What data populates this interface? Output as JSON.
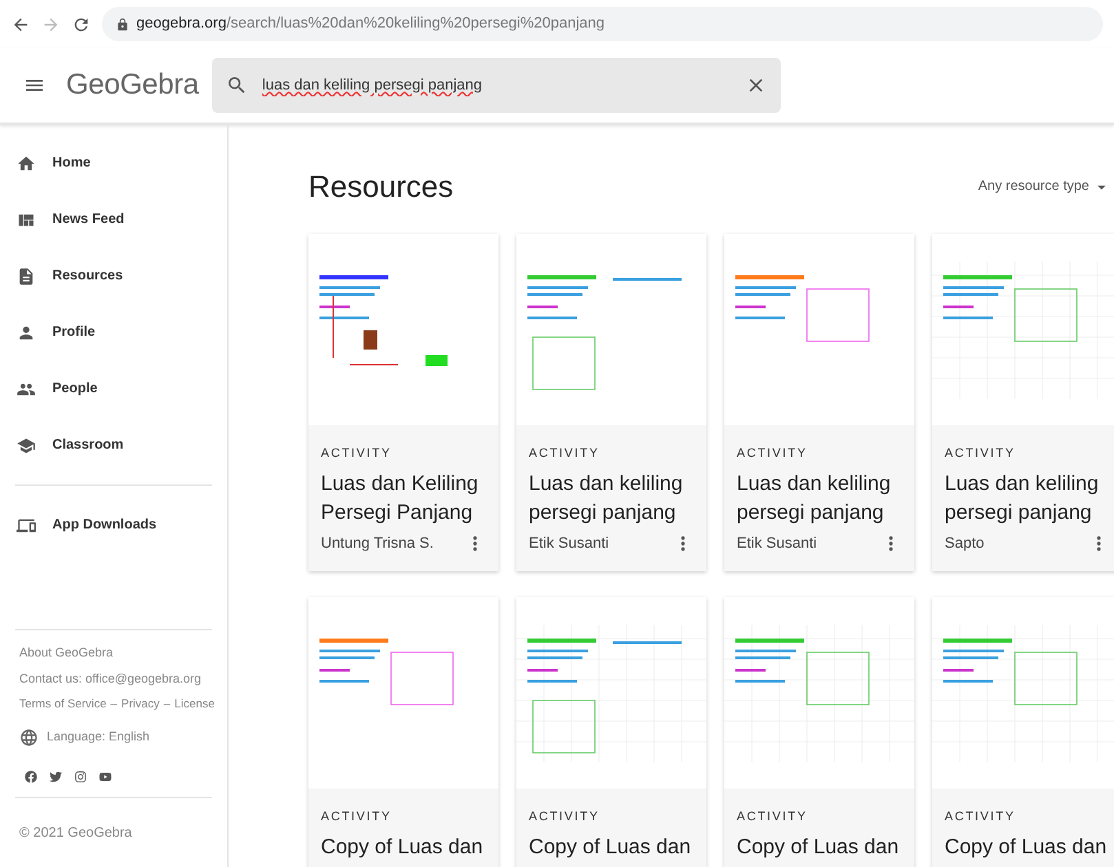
{
  "browser": {
    "url_host": "geogebra.org",
    "url_path": "/search/luas%20dan%20keliling%20persegi%20panjang"
  },
  "header": {
    "logo": "GeoGebra",
    "search": {
      "value": "luas dan keliling persegi panjang"
    }
  },
  "sidebar": {
    "items": [
      {
        "kind": "home",
        "label": "Home"
      },
      {
        "kind": "feed",
        "label": "News Feed"
      },
      {
        "kind": "resources",
        "label": "Resources"
      },
      {
        "kind": "profile",
        "label": "Profile"
      },
      {
        "kind": "people",
        "label": "People"
      },
      {
        "kind": "classroom",
        "label": "Classroom"
      }
    ],
    "extra_items": [
      {
        "kind": "downloads",
        "label": "App Downloads"
      }
    ],
    "footer": {
      "about": "About GeoGebra",
      "contact": "Contact us: office@geogebra.org",
      "links": [
        "Terms of Service",
        "Privacy",
        "License"
      ],
      "separator": "–",
      "language": "Language: English",
      "copyright": "© 2021 GeoGebra"
    }
  },
  "content": {
    "title": "Resources",
    "filter": "Any resource type",
    "cards": [
      {
        "type": "ACTIVITY",
        "title": "Luas dan Keliling Persegi Panjang",
        "author": "Untung Trisna S."
      },
      {
        "type": "ACTIVITY",
        "title": "Luas dan keliling persegi panjang",
        "author": "Etik Susanti"
      },
      {
        "type": "ACTIVITY",
        "title": "Luas dan keliling persegi panjang",
        "author": "Etik Susanti"
      },
      {
        "type": "ACTIVITY",
        "title": "Luas dan keliling persegi panjang",
        "author": "Sapto"
      },
      {
        "type": "ACTIVITY",
        "title": "Copy of Luas dan"
      },
      {
        "type": "ACTIVITY",
        "title": "Copy of Luas dan"
      },
      {
        "type": "ACTIVITY",
        "title": "Copy of Luas dan"
      },
      {
        "type": "ACTIVITY",
        "title": "Copy of Luas dan"
      }
    ]
  }
}
